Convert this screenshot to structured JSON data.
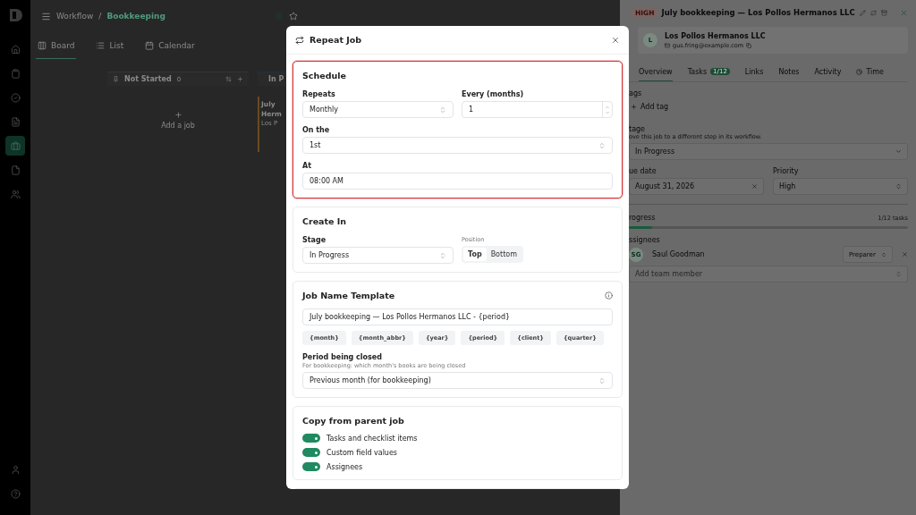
{
  "sidebar": {
    "items": [
      {
        "selected": false
      },
      {
        "selected": false
      },
      {
        "selected": false
      },
      {
        "selected": false
      },
      {
        "selected": true
      },
      {
        "selected": false
      },
      {
        "selected": false
      }
    ],
    "bottom_items": [
      {
        "selected": false
      },
      {
        "selected": false
      }
    ]
  },
  "board": {
    "breadcrumb": [
      "Workflow",
      "/",
      "Bookkeeping"
    ],
    "views": [
      {
        "label": "Board",
        "selected": true
      },
      {
        "label": "List",
        "selected": false
      },
      {
        "label": "Calendar",
        "selected": false
      }
    ],
    "columns": [
      {
        "name": "Not Started",
        "count": "0",
        "add_label": "Add a job"
      },
      {
        "name": "In P",
        "card": {
          "title_lines": [
            "July",
            "Herm"
          ],
          "client": "Los P"
        }
      }
    ]
  },
  "job_panel": {
    "priority": "HIGH",
    "title": "July bookkeeping — Los Pollos Hermanos LLC",
    "client": {
      "avatar": "L",
      "name": "Los Pollos Hermanos LLC",
      "email": "gus.fring@example.com"
    },
    "tabs": [
      {
        "label": "Overview",
        "selected": true
      },
      {
        "label": "Tasks",
        "badge": "1/12",
        "selected": false
      },
      {
        "label": "Links",
        "selected": false
      },
      {
        "label": "Notes",
        "selected": false
      },
      {
        "label": "Activity",
        "selected": false
      },
      {
        "label": "Time",
        "selected": false
      }
    ],
    "tags": {
      "label": "ags",
      "add": "Add tag"
    },
    "stage": {
      "label": "tage",
      "hint": "ove this job to a different step in its workflow.",
      "value": "In Progress"
    },
    "due_date": {
      "label": "ue date",
      "value": "August 31, 2026"
    },
    "priority_field": {
      "label": "Priority",
      "value": "High"
    },
    "progress": {
      "label": "rogress",
      "reading": "1/12 tasks",
      "level": 0.083
    },
    "assignees": {
      "label": "ssignees",
      "items": [
        {
          "initials": "SG",
          "name": "Saul Goodman",
          "role": "Preparer"
        }
      ],
      "placeholder": "Add team member"
    }
  },
  "modal": {
    "title": "Repeat Job",
    "schedule": {
      "title": "Schedule",
      "highlighted": true,
      "repeats": {
        "label": "Repeats",
        "value": "Monthly"
      },
      "every": {
        "label": "Every (months)",
        "value": "1"
      },
      "on_the": {
        "label": "On the",
        "value": "1st"
      },
      "at": {
        "label": "At",
        "value": "08:00 AM"
      }
    },
    "create_in": {
      "title": "Create In",
      "highlighted": false,
      "stage": {
        "label": "Stage",
        "value": "In Progress"
      },
      "position": {
        "label": "Position",
        "options": [
          {
            "label": "Top",
            "selected": true
          },
          {
            "label": "Bottom",
            "selected": false
          }
        ]
      }
    },
    "job_name_template": {
      "title": "Job Name Template",
      "highlighted": false,
      "value": "July bookkeeping — Los Pollos Hermanos LLC - {period}",
      "tokens": [
        "{month}",
        "{month_abbr}",
        "{year}",
        "{period}",
        "{client}",
        "{quarter}"
      ],
      "period": {
        "label": "Period being closed",
        "hint": "For bookkeeping: which month's books are being closed",
        "value": "Previous month (for bookkeeping)"
      }
    },
    "copy_from_parent": {
      "title": "Copy from parent job",
      "highlighted": false,
      "toggles": [
        {
          "label": "Tasks and checklist items",
          "on": true
        },
        {
          "label": "Custom field values",
          "on": true
        },
        {
          "label": "Assignees",
          "on": true
        }
      ]
    }
  }
}
